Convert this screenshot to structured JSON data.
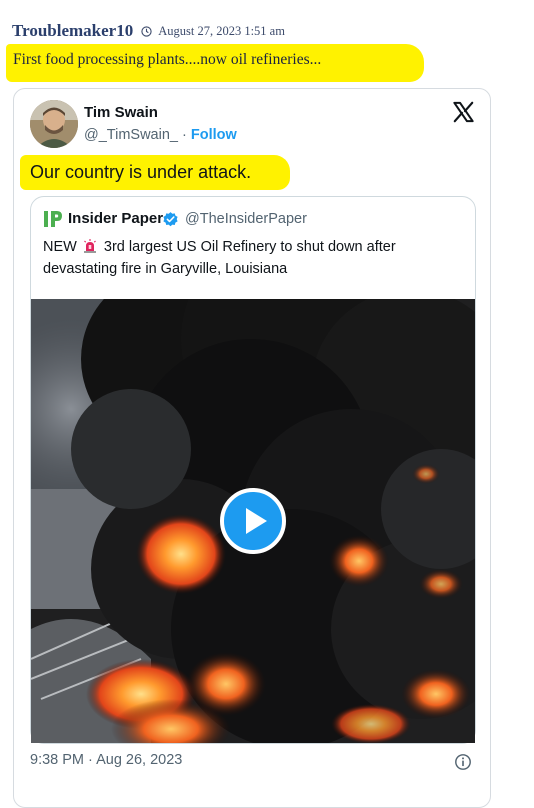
{
  "post": {
    "username": "Troublemaker10",
    "timestamp": "August 27, 2023 1:51 am",
    "text": "First food processing plants....now oil refineries...",
    "highlight_color": "#fff200"
  },
  "embed": {
    "author_name": "Tim Swain",
    "author_handle": "@_TimSwain_",
    "separator": " · ",
    "follow_label": "Follow",
    "text": "Our country is under attack.",
    "platform_icon": "x-logo-icon",
    "accent_color": "#1d9bf0",
    "quote": {
      "author_name": "Insider Paper",
      "author_handle": "@TheInsiderPaper",
      "text_before_icon": "NEW",
      "icon": "siren-icon",
      "text_after_icon": "3rd largest US Oil Refinery to shut down after devastating fire in Garyville, Louisiana",
      "media_type": "video",
      "media_icon": "play-icon"
    },
    "footer_time": "9:38 PM · Aug 26, 2023",
    "footer_icon": "info-icon"
  }
}
